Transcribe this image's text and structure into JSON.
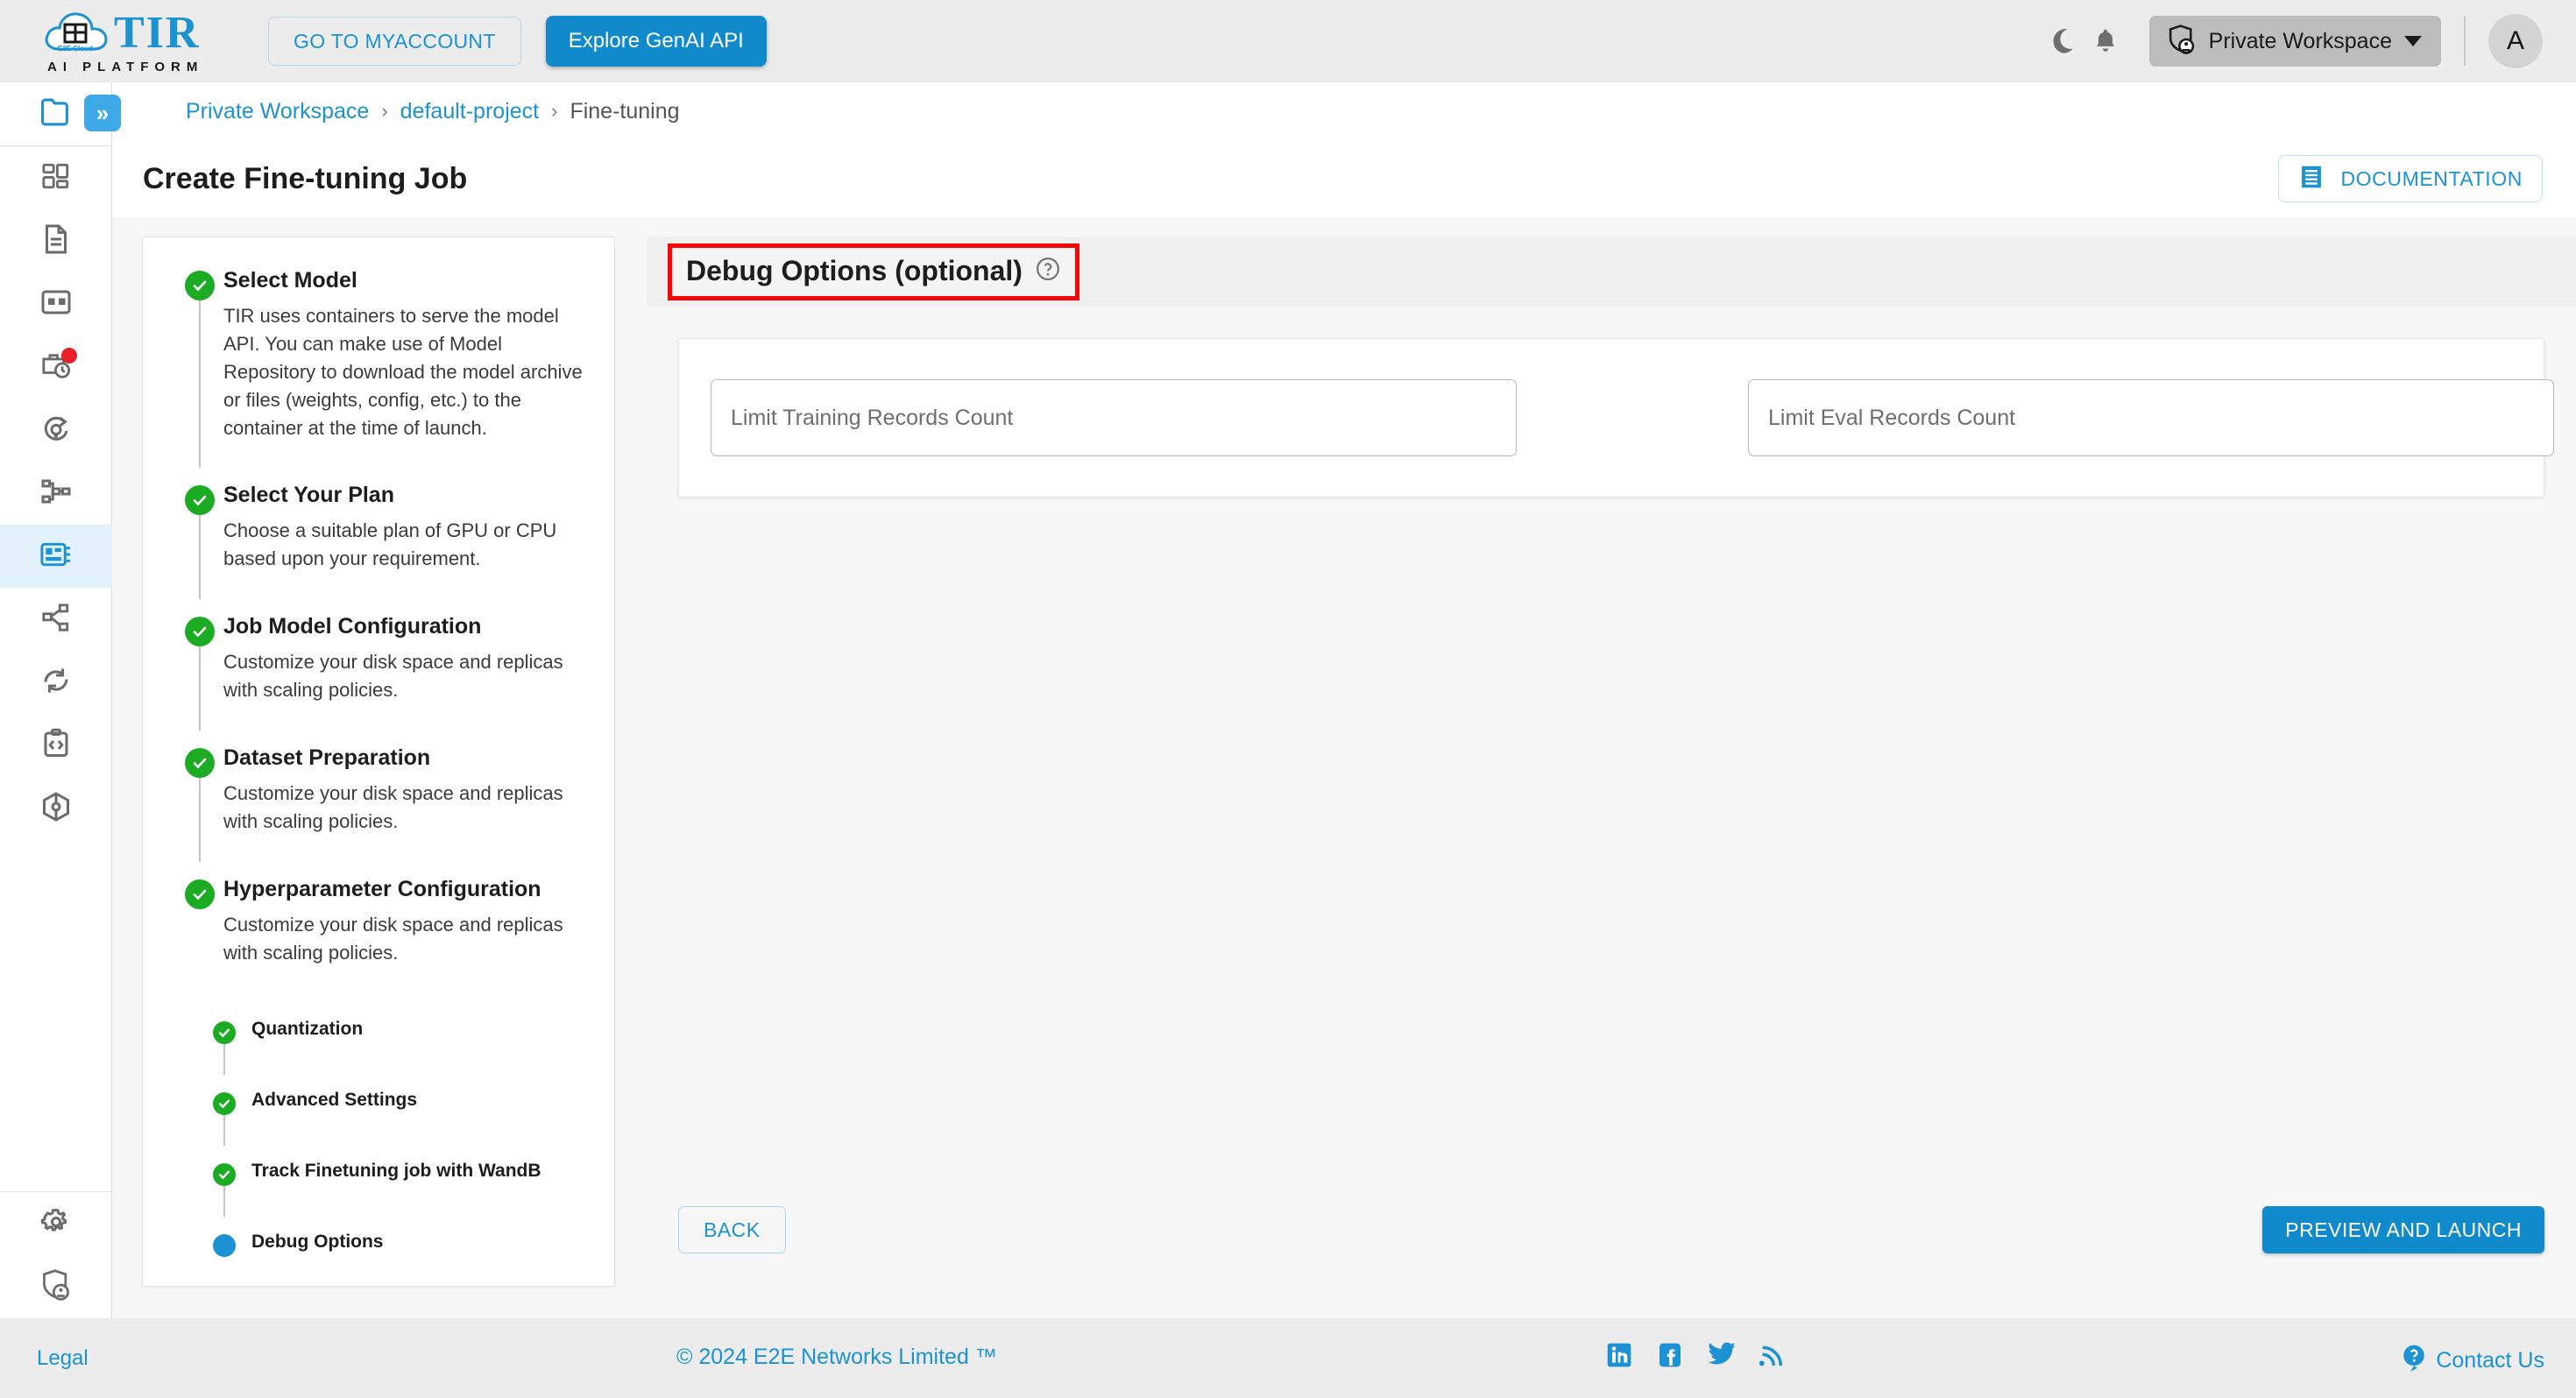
{
  "brand": {
    "logo_title": "TIR",
    "logo_subtitle": "AI PLATFORM",
    "logo_cloud_text": "E2E Cloud",
    "accent_blue": "#1c92d2",
    "button_blue": "#118acb",
    "highlight_red": "#fb0404",
    "step_green": "#1bac23"
  },
  "topbar": {
    "myaccount_label": "GO TO MYACCOUNT",
    "genai_label": "Explore GenAI API",
    "theme_icon": "moon-icon",
    "bell_icon": "bell-icon",
    "workspace_icon": "shield-user-icon",
    "workspace_label": "Private Workspace",
    "avatar_initial": "A"
  },
  "breadcrumb": {
    "toggle_glyph": "»",
    "items": [
      {
        "label": "Private Workspace",
        "link": true
      },
      {
        "label": "default-project",
        "link": true
      },
      {
        "label": "Fine-tuning",
        "link": false
      }
    ],
    "separator": "›"
  },
  "rail": {
    "items": [
      {
        "name": "folder-icon",
        "active_color": true
      },
      {
        "name": "dashboard-icon"
      },
      {
        "name": "document-icon"
      },
      {
        "name": "grid-card-icon"
      },
      {
        "name": "briefcase-clock-icon",
        "badge": true
      },
      {
        "name": "refresh-bulb-icon"
      },
      {
        "name": "pipeline-icon"
      },
      {
        "name": "finetune-card-icon",
        "selected": true
      },
      {
        "name": "share-nodes-icon"
      },
      {
        "name": "sync-icon"
      },
      {
        "name": "code-clipboard-icon"
      },
      {
        "name": "cube-icon"
      },
      {
        "name": "gear-icon"
      },
      {
        "name": "shield-user-icon"
      }
    ]
  },
  "page": {
    "title": "Create Fine-tuning Job",
    "documentation_label": "DOCUMENTATION",
    "documentation_icon": "book-icon"
  },
  "stepper": {
    "steps": [
      {
        "title": "Select Model",
        "desc": "TIR uses containers to serve the model API. You can make use of Model Repository to download the model archive or files (weights, config, etc.) to the container at the time of launch.",
        "state": "done",
        "level": "main"
      },
      {
        "title": "Select Your Plan",
        "desc": "Choose a suitable plan of GPU or CPU based upon your requirement.",
        "state": "done",
        "level": "main"
      },
      {
        "title": "Job Model Configuration",
        "desc": "Customize your disk space and replicas with scaling policies.",
        "state": "done",
        "level": "main"
      },
      {
        "title": "Dataset Preparation",
        "desc": "Customize your disk space and replicas with scaling policies.",
        "state": "done",
        "level": "main"
      },
      {
        "title": "Hyperparameter Configuration",
        "desc": "Customize your disk space and replicas with scaling policies.",
        "state": "done",
        "level": "main"
      },
      {
        "title": "Quantization",
        "desc": "",
        "state": "done",
        "level": "sub"
      },
      {
        "title": "Advanced Settings",
        "desc": "",
        "state": "done",
        "level": "sub"
      },
      {
        "title": "Track Finetuning job with WandB",
        "desc": "",
        "state": "done",
        "level": "sub"
      },
      {
        "title": "Debug Options",
        "desc": "",
        "state": "current",
        "level": "sub"
      }
    ]
  },
  "section": {
    "title": "Debug Options (optional)",
    "help_icon": "help-circle-icon",
    "highlighted": true
  },
  "form": {
    "fields": [
      {
        "name": "limit-training-records-count",
        "placeholder": "Limit Training Records Count",
        "value": ""
      },
      {
        "name": "limit-eval-records-count",
        "placeholder": "Limit Eval Records Count",
        "value": ""
      }
    ]
  },
  "actions": {
    "back_label": "BACK",
    "launch_label": "PREVIEW AND LAUNCH"
  },
  "footer": {
    "legal_label": "Legal",
    "copyright": "© 2024 E2E Networks Limited ™",
    "social": [
      {
        "name": "linkedin-icon"
      },
      {
        "name": "facebook-icon"
      },
      {
        "name": "twitter-icon"
      },
      {
        "name": "rss-icon"
      }
    ],
    "contact_label": "Contact Us",
    "contact_icon": "question-balloon-icon"
  }
}
